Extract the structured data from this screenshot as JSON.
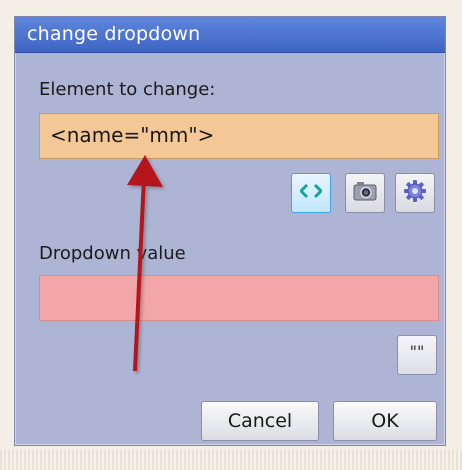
{
  "dialog": {
    "title": "change dropdown",
    "element_label": "Element to change:",
    "element_value": "<name=\"mm\">",
    "dropdown_label": "Dropdown value",
    "dropdown_value": "",
    "quote_button": "\"\"",
    "cancel_label": "Cancel",
    "ok_label": "OK"
  },
  "toolbar": {
    "icons": [
      "code-icon",
      "camera-icon",
      "gear-icon"
    ]
  },
  "colors": {
    "title_bar": "#4a72d0",
    "dialog_bg": "#aeb4d4",
    "element_field": "#f3c796",
    "dropdown_field": "#f3a6a8",
    "arrow": "#b5121b"
  }
}
